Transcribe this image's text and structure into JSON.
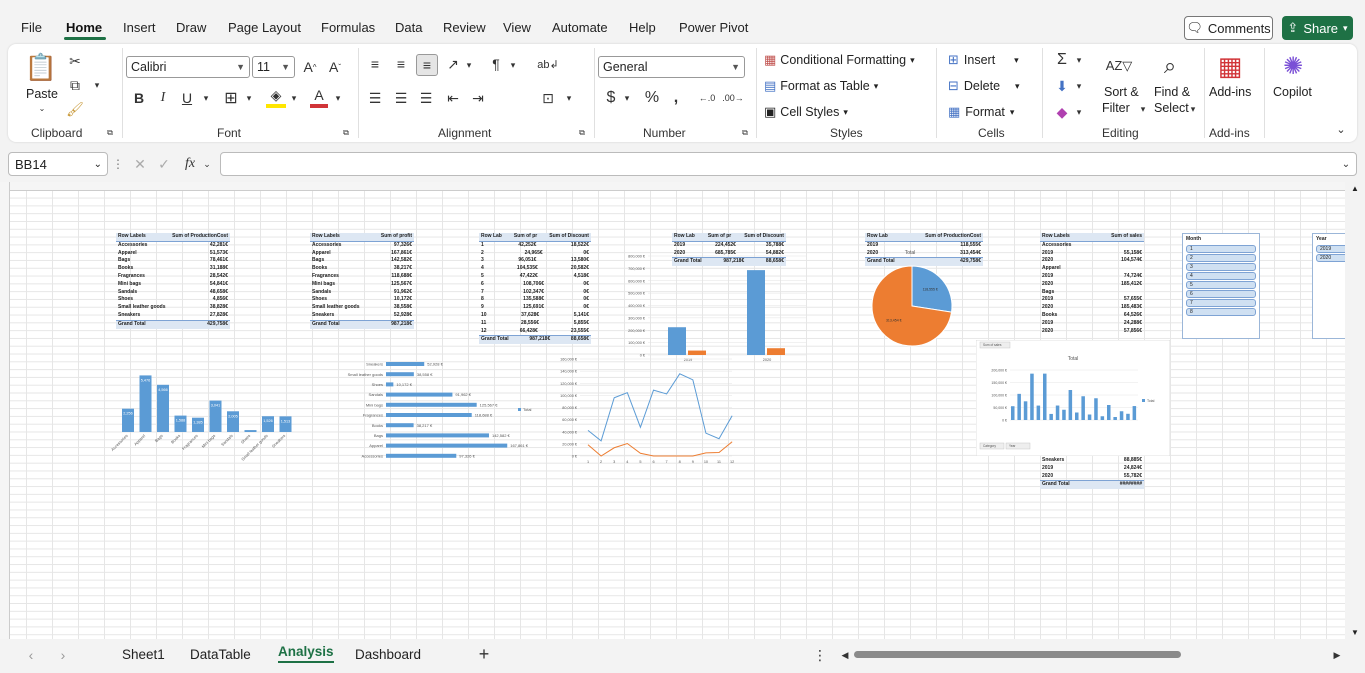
{
  "menu": {
    "tabs": [
      "File",
      "Home",
      "Insert",
      "Draw",
      "Page Layout",
      "Formulas",
      "Data",
      "Review",
      "View",
      "Automate",
      "Help",
      "Power Pivot"
    ],
    "active": "Home",
    "comments": "Comments",
    "share": "Share"
  },
  "ribbon": {
    "clipboard": {
      "paste": "Paste",
      "label": "Clipboard"
    },
    "font": {
      "name": "Calibri",
      "size": "11",
      "label": "Font"
    },
    "alignment": {
      "label": "Alignment"
    },
    "number": {
      "format": "General",
      "label": "Number"
    },
    "styles": {
      "conditional": "Conditional Formatting",
      "table": "Format as Table",
      "cell_styles": "Cell Styles",
      "label": "Styles"
    },
    "cells": {
      "insert": "Insert",
      "delete": "Delete",
      "format": "Format",
      "label": "Cells"
    },
    "editing": {
      "sort": "Sort &",
      "sort2": "Filter",
      "find": "Find &",
      "find2": "Select",
      "label": "Editing"
    },
    "addins": {
      "addins": "Add-ins",
      "label": "Add-ins"
    },
    "copilot": "Copilot",
    "colors": {
      "accent": "#1e7145",
      "font_red": "#d13438",
      "highlight": "#ffe600"
    }
  },
  "formula_bar": {
    "name_box": "BB14",
    "fx": "fx",
    "formula": ""
  },
  "sheet_tabs": [
    "Sheet1",
    "DataTable",
    "Analysis",
    "Dashboard"
  ],
  "active_sheet": "Analysis",
  "pivot1": {
    "header": [
      "Row Labels",
      "Sum of ProductionCost"
    ],
    "rows": [
      [
        "Accessories",
        "42,281€"
      ],
      [
        "Apparel",
        "51,573€"
      ],
      [
        "Bags",
        "78,461€"
      ],
      [
        "Books",
        "31,188€"
      ],
      [
        "Fragrances",
        "28,542€"
      ],
      [
        "Mini bags",
        "54,841€"
      ],
      [
        "Sandals",
        "48,658€"
      ],
      [
        "Shoes",
        "4,856€"
      ],
      [
        "Small leather goods",
        "38,828€"
      ],
      [
        "Sneakers",
        "27,828€"
      ]
    ],
    "total": [
      "Grand Total",
      "429,758€"
    ]
  },
  "pivot2": {
    "header": [
      "Row Labels",
      "Sum of profit"
    ],
    "rows": [
      [
        "Accessories",
        "97,326€"
      ],
      [
        "Apparel",
        "167,861€"
      ],
      [
        "Bags",
        "142,582€"
      ],
      [
        "Books",
        "38,217€"
      ],
      [
        "Fragrances",
        "118,688€"
      ],
      [
        "Mini bags",
        "125,567€"
      ],
      [
        "Sandals",
        "91,962€"
      ],
      [
        "Shoes",
        "10,172€"
      ],
      [
        "Small leather goods",
        "38,558€"
      ],
      [
        "Sneakers",
        "52,928€"
      ]
    ],
    "total": [
      "Grand Total",
      "987,218€"
    ]
  },
  "pivot3": {
    "header": [
      "Row Lab",
      "Sum of pr",
      "Sum of Discount"
    ],
    "rows": [
      [
        "1",
        "42,252€",
        "18,522€"
      ],
      [
        "2",
        "24,965€",
        "0€"
      ],
      [
        "3",
        "96,051€",
        "13,580€"
      ],
      [
        "4",
        "104,535€",
        "20,582€"
      ],
      [
        "5",
        "47,422€",
        "4,518€"
      ],
      [
        "6",
        "108,706€",
        "0€"
      ],
      [
        "7",
        "102,347€",
        "0€"
      ],
      [
        "8",
        "135,588€",
        "0€"
      ],
      [
        "9",
        "125,691€",
        "0€"
      ],
      [
        "10",
        "37,628€",
        "5,141€"
      ],
      [
        "11",
        "28,556€",
        "5,855€"
      ],
      [
        "12",
        "66,428€",
        "23,555€"
      ]
    ],
    "total": [
      "Grand Total",
      "987,218€",
      "88,658€"
    ]
  },
  "pivot4": {
    "header": [
      "Row Lab",
      "Sum of pr",
      "Sum of Discount"
    ],
    "rows": [
      [
        "2019",
        "224,452€",
        "35,788€"
      ],
      [
        "2020",
        "685,785€",
        "54,882€"
      ]
    ],
    "total": [
      "Grand Total",
      "987,218€",
      "88,658€"
    ]
  },
  "pivot5": {
    "header": [
      "Row Lab",
      "Sum of ProductionCost"
    ],
    "rows": [
      [
        "2019",
        "118,555€"
      ],
      [
        "2020",
        "313,454€"
      ]
    ],
    "total": [
      "Grand Total",
      "429,758€"
    ]
  },
  "pivot6": {
    "header": [
      "Row Labels",
      "Sum of sales"
    ],
    "rows": [
      [
        "Accessories",
        ""
      ],
      [
        "2019",
        "55,158€"
      ],
      [
        "2020",
        "104,574€"
      ],
      [
        "Apparel",
        ""
      ],
      [
        "2019",
        "74,724€"
      ],
      [
        "2020",
        "185,412€"
      ],
      [
        "Bags",
        ""
      ],
      [
        "2019",
        "57,655€"
      ],
      [
        "2020",
        "185,483€"
      ],
      [
        "Books",
        "64,526€"
      ],
      [
        "2019",
        "24,288€"
      ],
      [
        "2020",
        "57,856€"
      ]
    ],
    "rows_bottom": [
      [
        "Sneakers",
        "88,885€"
      ],
      [
        "2019",
        "24,824€"
      ],
      [
        "2020",
        "55,782€"
      ]
    ],
    "total": [
      "Grand Total",
      "########"
    ]
  },
  "slicer_month": {
    "title": "Month",
    "items": [
      "1",
      "2",
      "3",
      "4",
      "5",
      "6",
      "7",
      "8"
    ]
  },
  "slicer_year": {
    "title": "Year",
    "items": [
      "2019",
      "2020"
    ]
  },
  "chart_data": [
    {
      "type": "bar",
      "categories": [
        "Accessories",
        "Apparel",
        "Bags",
        "Books",
        "Fragrances",
        "Mini bags",
        "Sandals",
        "Shoes",
        "Small leather goods",
        "Sneakers"
      ],
      "values": [
        2.256,
        5.476,
        4.566,
        1.588,
        1.385,
        3.041,
        2.005,
        0.185,
        1.526,
        1.513
      ],
      "data_labels": [
        "2,256",
        "5,476",
        "4,566",
        "1,588",
        "1,385",
        "3,041",
        "2,005",
        "",
        "1,526",
        "1,513"
      ],
      "ylim": [
        0,
        6
      ],
      "grid": false
    },
    {
      "type": "bar",
      "orientation": "horizontal",
      "categories": [
        "Sneakers",
        "Small leather goods",
        "Shoes",
        "Sandals",
        "Mini bags",
        "Fragrances",
        "Books",
        "Bags",
        "Apparel",
        "Accessories"
      ],
      "values": [
        52928,
        38558,
        10172,
        91962,
        125567,
        118688,
        38217,
        142582,
        167861,
        97326
      ],
      "data_labels": [
        "52,928 €",
        "38,558 €",
        "10,172 €",
        "91,962 €",
        "125,567 €",
        "118,688 €",
        "38,217 €",
        "142,582 €",
        "167,861 €",
        "97,326 €"
      ],
      "legend": [
        "Total"
      ],
      "xlim": [
        0,
        180000
      ]
    },
    {
      "type": "bar",
      "categories": [
        "2019",
        "2020"
      ],
      "series": [
        {
          "values": [
            224452,
            685785
          ]
        },
        {
          "values": [
            35788,
            54882
          ]
        }
      ],
      "ylim": [
        0,
        800000
      ],
      "yticks": [
        "0 €",
        "100,000 €",
        "200,000 €",
        "300,000 €",
        "400,000 €",
        "500,000 €",
        "600,000 €",
        "700,000 €",
        "800,000 €"
      ],
      "grid": true
    },
    {
      "type": "line",
      "x": [
        "1",
        "2",
        "3",
        "4",
        "5",
        "6",
        "7",
        "8",
        "9",
        "10",
        "11",
        "12"
      ],
      "series": [
        {
          "values": [
            42252,
            24965,
            96051,
            104535,
            47422,
            108706,
            102347,
            135588,
            125691,
            37628,
            28556,
            66428
          ]
        },
        {
          "values": [
            18522,
            0,
            13580,
            20582,
            4518,
            0,
            0,
            0,
            0,
            5141,
            5855,
            23555
          ]
        }
      ],
      "ylim": [
        0,
        160000
      ],
      "yticks": [
        "0 €",
        "20,000 €",
        "40,000 €",
        "60,000 €",
        "80,000 €",
        "100,000 €",
        "120,000 €",
        "140,000 €",
        "160,000 €"
      ],
      "grid": true
    },
    {
      "type": "pie",
      "title": "Total",
      "categories": [
        "2019",
        "2020"
      ],
      "values": [
        118555,
        313454
      ],
      "data_labels": [
        "118,555 €",
        "313,454 €"
      ]
    },
    {
      "type": "bar",
      "title": "Total",
      "legend": [
        "Total"
      ],
      "values": [
        55158,
        104574,
        74724,
        185412,
        57655,
        185483,
        24288,
        57856,
        41000,
        120000,
        30000,
        95000,
        22000,
        87000,
        15000,
        60000,
        12000,
        35000,
        24824,
        55782
      ],
      "ylim": [
        0,
        200000
      ],
      "yticks": [
        "0 €",
        "50,000 €",
        "100,000 €",
        "150,000 €",
        "200,000 €"
      ],
      "field_button": "Sum of sales",
      "category_buttons": [
        "Category",
        "Year"
      ]
    }
  ],
  "colors": {
    "series_blue": "#5b9bd5",
    "series_orange": "#ed7d31",
    "pivot_header": "#dde7f3"
  }
}
